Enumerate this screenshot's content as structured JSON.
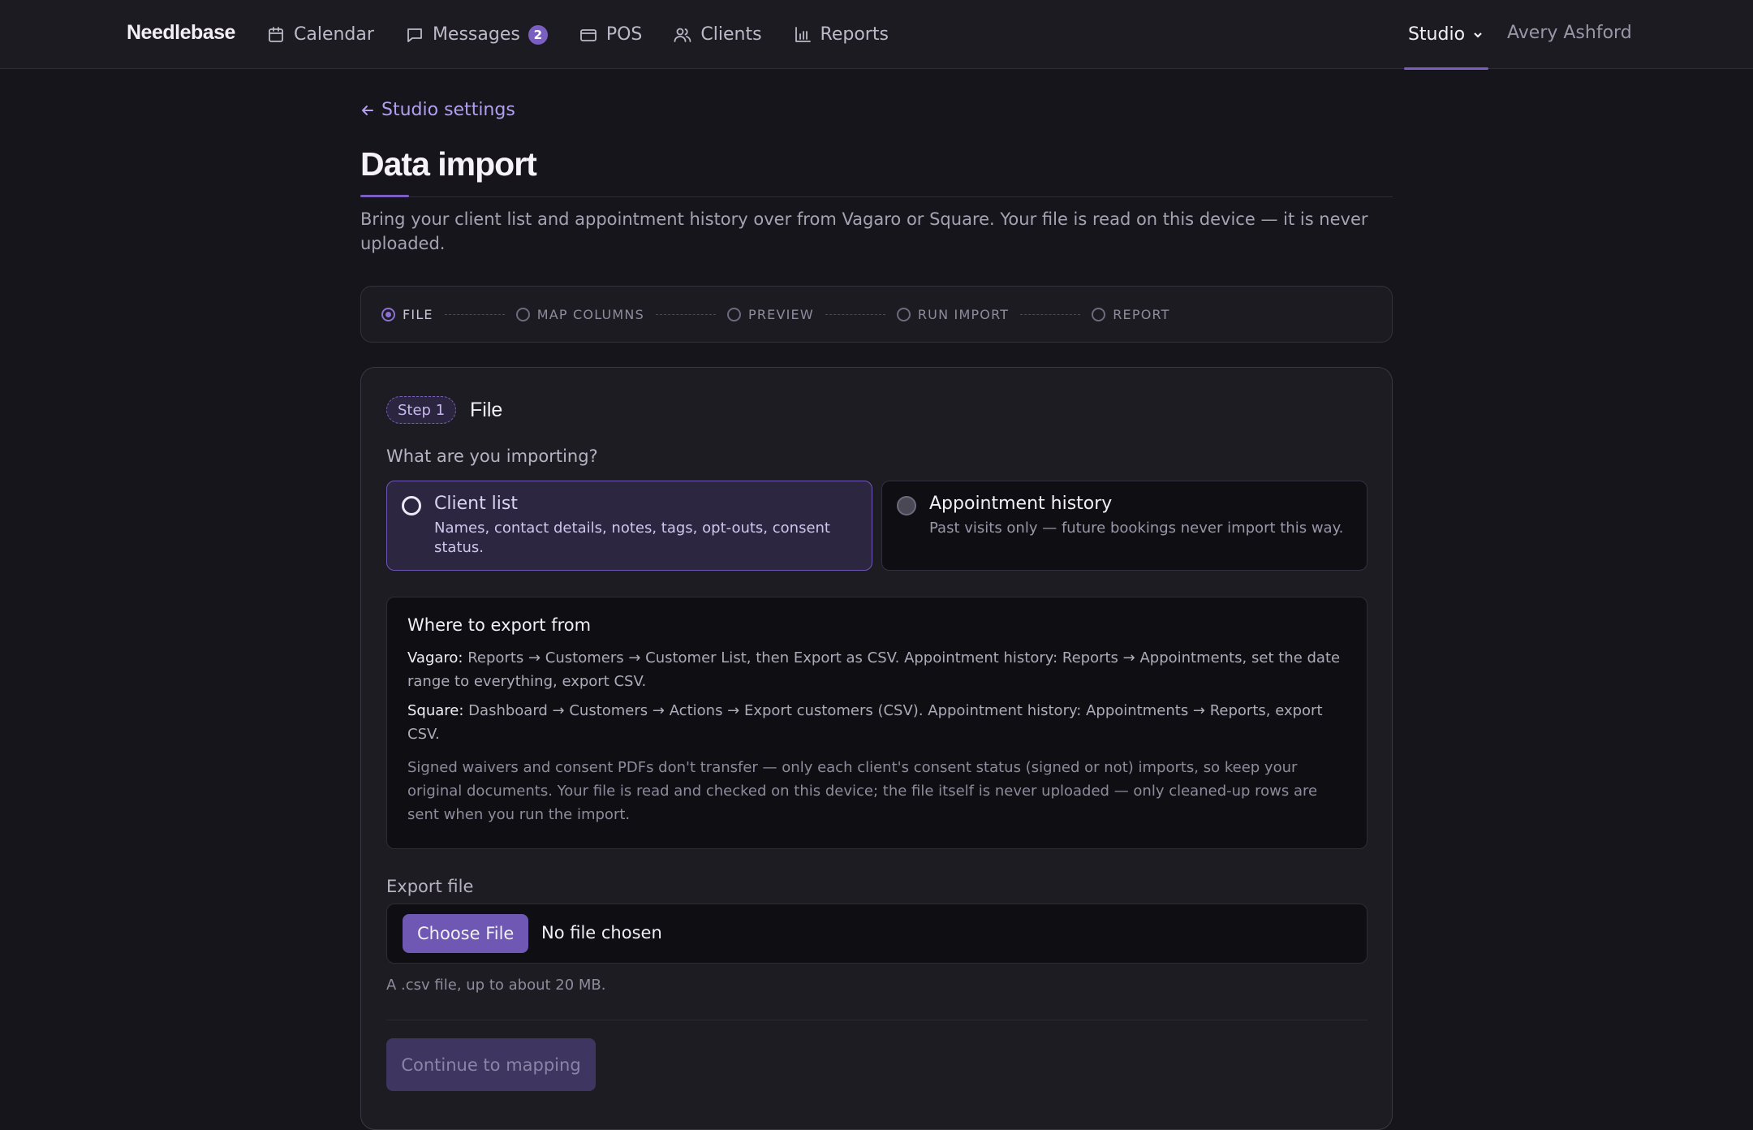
{
  "brand": "Needlebase",
  "nav": {
    "items": [
      {
        "label": "Calendar",
        "icon": "calendar-icon"
      },
      {
        "label": "Messages",
        "icon": "message-icon",
        "badge": "2"
      },
      {
        "label": "POS",
        "icon": "card-icon"
      },
      {
        "label": "Clients",
        "icon": "users-icon"
      },
      {
        "label": "Reports",
        "icon": "bar-chart-icon"
      }
    ],
    "studio_label": "Studio",
    "user_name": "Avery Ashford"
  },
  "page": {
    "back_label": "Studio settings",
    "title": "Data import",
    "description": "Bring your client list and appointment history over from Vagaro or Square. Your file is read on this device — it is never uploaded."
  },
  "stepper": {
    "steps": [
      "FILE",
      "MAP COLUMNS",
      "PREVIEW",
      "RUN IMPORT",
      "REPORT"
    ],
    "active_index": 0
  },
  "card": {
    "step_badge": "Step 1",
    "title": "File",
    "question": "What are you importing?",
    "options": [
      {
        "title": "Client list",
        "description": "Names, contact details, notes, tags, opt-outs, consent status.",
        "selected": true
      },
      {
        "title": "Appointment history",
        "description": "Past visits only — future bookings never import this way.",
        "selected": false
      }
    ],
    "info": {
      "heading": "Where to export from",
      "vagaro_label": "Vagaro:",
      "vagaro_text": "Reports → Customers → Customer List, then Export as CSV. Appointment history: Reports → Appointments, set the date range to everything, export CSV.",
      "square_label": "Square:",
      "square_text": "Dashboard → Customers → Actions → Export customers (CSV). Appointment history: Appointments → Reports, export CSV.",
      "note": "Signed waivers and consent PDFs don't transfer — only each client's consent status (signed or not) imports, so keep your original documents. Your file is read and checked on this device; the file itself is never uploaded — only cleaned-up rows are sent when you run the import."
    },
    "file": {
      "label": "Export file",
      "button": "Choose File",
      "status": "No file chosen",
      "hint": "A .csv file, up to about 20 MB."
    },
    "continue_label": "Continue to mapping"
  },
  "colors": {
    "accent": "#7a5fc0",
    "background": "#16151b",
    "surface": "#1d1c23"
  }
}
